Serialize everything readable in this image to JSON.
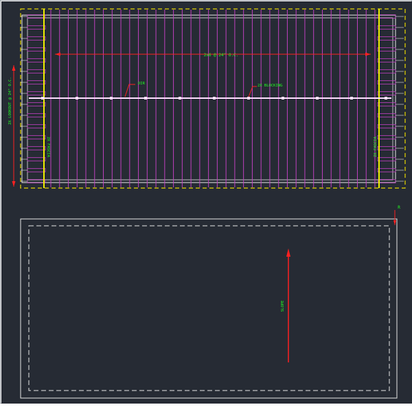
{
  "colors": {
    "background": "#262b34",
    "dimension": "#ff2020",
    "rafter": "#c040c0",
    "outline_white": "#e8e8e8",
    "text_green": "#20ff20",
    "yellow": "#f0f000",
    "yellow_dashed": "#e6d600",
    "ridge": "#ffe0ff"
  },
  "plan": {
    "spacing_label": "2x6 @ 24\" O.C.",
    "ridge_label": "DIR",
    "blocking_label": "2X BLOCKING",
    "joist_label": "2X LOOKOUT @ 24\" O.C.",
    "left_end_label": "2X FASCIA",
    "right_end_label": "2X FASCIA"
  },
  "roof": {
    "slope_label": "SLOPE",
    "marker_label": "R"
  }
}
